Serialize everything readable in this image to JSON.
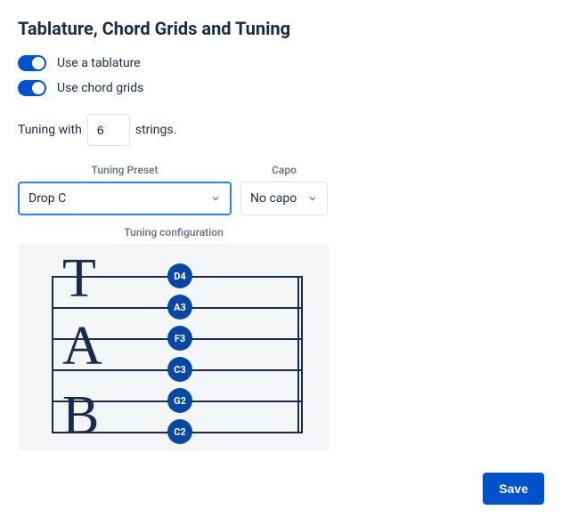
{
  "title": "Tablature, Chord Grids and Tuning",
  "toggles": {
    "tablature_label": "Use a tablature",
    "chord_grids_label": "Use chord grids"
  },
  "tuning": {
    "prefix": "Tuning with",
    "strings_value": "6",
    "suffix": "strings."
  },
  "preset": {
    "label": "Tuning Preset",
    "value": "Drop C"
  },
  "capo": {
    "label": "Capo",
    "value": "No capo"
  },
  "config_label": "Tuning configuration",
  "string_notes": [
    "D4",
    "A3",
    "F3",
    "C3",
    "G2",
    "C2"
  ],
  "save_label": "Save"
}
